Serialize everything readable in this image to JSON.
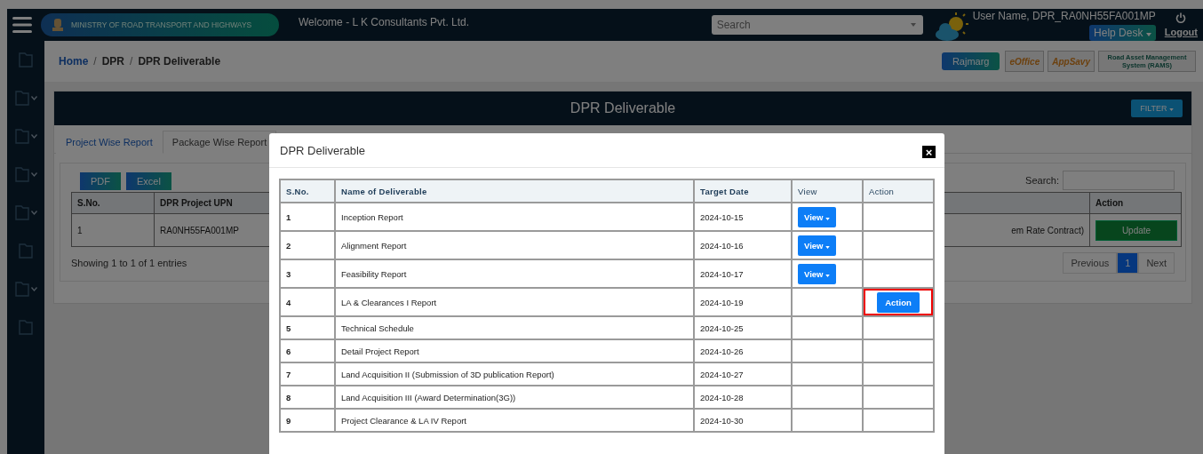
{
  "header": {
    "ministry": "MINISTRY OF ROAD TRANSPORT AND HIGHWAYS",
    "welcome": "Welcome - L K Consultants Pvt. Ltd.",
    "search": {
      "placeholder": "Search"
    },
    "user": "User Name, DPR_RA0NH55FA001MP",
    "help_desk": "Help Desk",
    "logout": "Logout"
  },
  "sidebar": {
    "items": [
      {
        "expandable": false
      },
      {
        "expandable": true
      },
      {
        "expandable": true
      },
      {
        "expandable": true
      },
      {
        "expandable": true
      },
      {
        "expandable": false
      },
      {
        "expandable": true
      },
      {
        "expandable": false
      }
    ]
  },
  "breadcrumb": {
    "separator": "/",
    "items": [
      {
        "label": "Home",
        "link": true
      },
      {
        "label": "DPR",
        "link": false
      },
      {
        "label": "DPR Deliverable",
        "link": false
      }
    ]
  },
  "quick_links": [
    {
      "label": "Rajmarg",
      "kind": "button"
    },
    {
      "label": "eOffice",
      "kind": "logo"
    },
    {
      "label": "AppSavy",
      "kind": "logo"
    },
    {
      "label": "Road Asset Management System (RAMS)",
      "kind": "logo"
    }
  ],
  "page": {
    "title": "DPR Deliverable",
    "filter": "FILTER",
    "tabs": [
      {
        "label": "Project Wise Report",
        "selected": false
      },
      {
        "label": "Package Wise Report",
        "selected": true
      }
    ],
    "export_buttons": [
      "PDF",
      "Excel"
    ],
    "search_label": "Search:",
    "table": {
      "columns": [
        "S.No.",
        "DPR Project UPN",
        "Action"
      ],
      "rows": [
        {
          "sno": "1",
          "upn": "RA0NH55FA001MP",
          "column_3": "em Rate Contract)",
          "action": "Update"
        }
      ]
    },
    "info": "Showing 1 to 1 of 1 entries",
    "pagination": [
      {
        "label": "Previous",
        "selected": false
      },
      {
        "label": "1",
        "selected": true
      },
      {
        "label": "Next",
        "selected": false
      }
    ]
  },
  "modal": {
    "title": "DPR Deliverable",
    "close": "×",
    "columns": [
      "S.No.",
      "Name of Deliverable",
      "Target Date",
      "View",
      "Action"
    ],
    "rows": [
      {
        "sno": "1",
        "name": "Inception Report",
        "date": "2024-10-15",
        "view": "View",
        "action": null,
        "highlighted": false
      },
      {
        "sno": "2",
        "name": "Alignment Report",
        "date": "2024-10-16",
        "view": "View",
        "action": null,
        "highlighted": false
      },
      {
        "sno": "3",
        "name": "Feasibility Report",
        "date": "2024-10-17",
        "view": "View",
        "action": null,
        "highlighted": false
      },
      {
        "sno": "4",
        "name": "LA & Clearances I Report",
        "date": "2024-10-19",
        "view": null,
        "action": "Action",
        "highlighted": true
      },
      {
        "sno": "5",
        "name": "Technical Schedule",
        "date": "2024-10-25",
        "view": null,
        "action": null,
        "highlighted": false
      },
      {
        "sno": "6",
        "name": "Detail Project Report",
        "date": "2024-10-26",
        "view": null,
        "action": null,
        "highlighted": false
      },
      {
        "sno": "7",
        "name": "Land Acquisition II (Submission of 3D publication Report)",
        "date": "2024-10-27",
        "view": null,
        "action": null,
        "highlighted": false
      },
      {
        "sno": "8",
        "name": "Land Acquisition III (Award Determination(3G))",
        "date": "2024-10-28",
        "view": null,
        "action": null,
        "highlighted": false
      },
      {
        "sno": "9",
        "name": "Project Clearance & LA IV Report",
        "date": "2024-10-30",
        "view": null,
        "action": null,
        "highlighted": false
      }
    ]
  }
}
